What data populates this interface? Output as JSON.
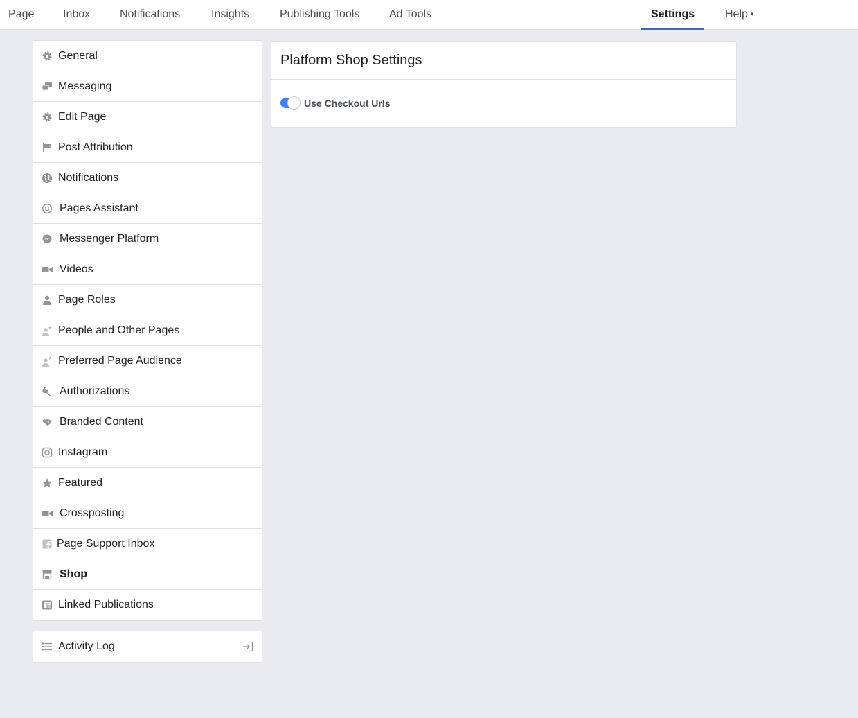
{
  "topnav": {
    "items": [
      {
        "label": "Page"
      },
      {
        "label": "Inbox"
      },
      {
        "label": "Notifications"
      },
      {
        "label": "Insights"
      },
      {
        "label": "Publishing Tools"
      },
      {
        "label": "Ad Tools"
      },
      {
        "label": "Settings",
        "active": true
      },
      {
        "label": "Help",
        "dropdown": true
      }
    ],
    "caret": "▾"
  },
  "sidebar": {
    "items": [
      {
        "label": "General",
        "icon": "gear-icon"
      },
      {
        "label": "Messaging",
        "icon": "chat-bubbles-icon"
      },
      {
        "label": "Edit Page",
        "icon": "gear-icon"
      },
      {
        "label": "Post Attribution",
        "icon": "flag-icon"
      },
      {
        "label": "Notifications",
        "icon": "globe-icon"
      },
      {
        "label": "Pages Assistant",
        "icon": "smiley-icon"
      },
      {
        "label": "Messenger Platform",
        "icon": "messenger-icon"
      },
      {
        "label": "Videos",
        "icon": "video-camera-icon"
      },
      {
        "label": "Page Roles",
        "icon": "person-icon"
      },
      {
        "label": "People and Other Pages",
        "icon": "person-star-icon"
      },
      {
        "label": "Preferred Page Audience",
        "icon": "person-star-icon"
      },
      {
        "label": "Authorizations",
        "icon": "wrench-icon"
      },
      {
        "label": "Branded Content",
        "icon": "handshake-icon"
      },
      {
        "label": "Instagram",
        "icon": "instagram-icon"
      },
      {
        "label": "Featured",
        "icon": "star-icon"
      },
      {
        "label": "Crossposting",
        "icon": "video-camera-icon"
      },
      {
        "label": "Page Support Inbox",
        "icon": "facebook-icon"
      },
      {
        "label": "Shop",
        "icon": "shop-icon",
        "active": true
      },
      {
        "label": "Linked Publications",
        "icon": "newspaper-icon"
      }
    ]
  },
  "activity": {
    "label": "Activity Log",
    "icon": "list-icon",
    "action_icon": "exit-icon"
  },
  "panel": {
    "title": "Platform Shop Settings",
    "toggle": {
      "label": "Use Checkout Urls",
      "on": true
    }
  },
  "colors": {
    "background": "#e9ebee",
    "accent": "#4267b2",
    "toggle_on": "#4080ff",
    "icon_gray": "#90949c",
    "text": "#1d2129"
  }
}
